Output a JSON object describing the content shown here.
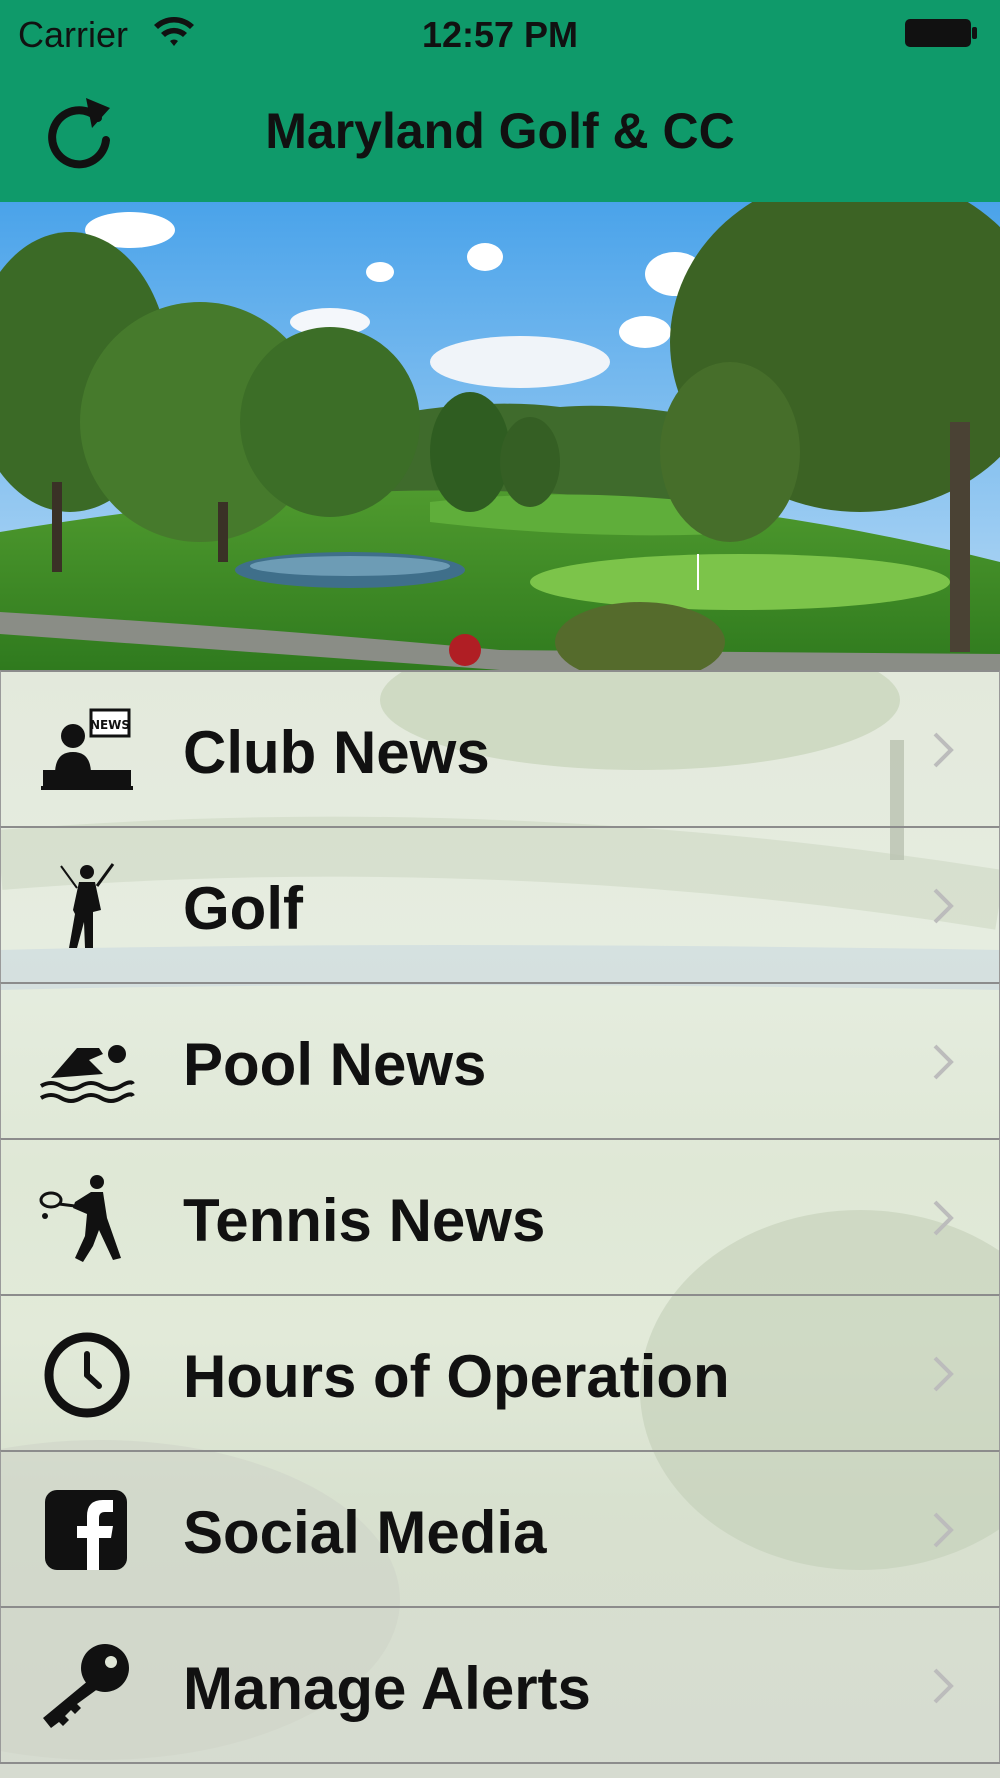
{
  "status_bar": {
    "carrier": "Carrier",
    "time": "12:57 PM",
    "wifi_icon": "wifi-icon",
    "battery_icon": "battery-icon"
  },
  "nav_bar": {
    "title": "Maryland Golf & CC",
    "refresh_icon": "refresh-icon",
    "background_color": "#0f9a6a"
  },
  "hero": {
    "image_icon": "golf-course-photo"
  },
  "menu": {
    "items": [
      {
        "label": "Club News",
        "icon": "news-anchor-icon"
      },
      {
        "label": "Golf",
        "icon": "golfer-icon"
      },
      {
        "label": "Pool News",
        "icon": "swimmer-icon"
      },
      {
        "label": "Tennis News",
        "icon": "tennis-player-icon"
      },
      {
        "label": "Hours of Operation",
        "icon": "clock-icon"
      },
      {
        "label": "Social Media",
        "icon": "facebook-icon"
      },
      {
        "label": "Manage Alerts",
        "icon": "key-icon"
      }
    ],
    "chevron_icon": "chevron-right-icon"
  }
}
